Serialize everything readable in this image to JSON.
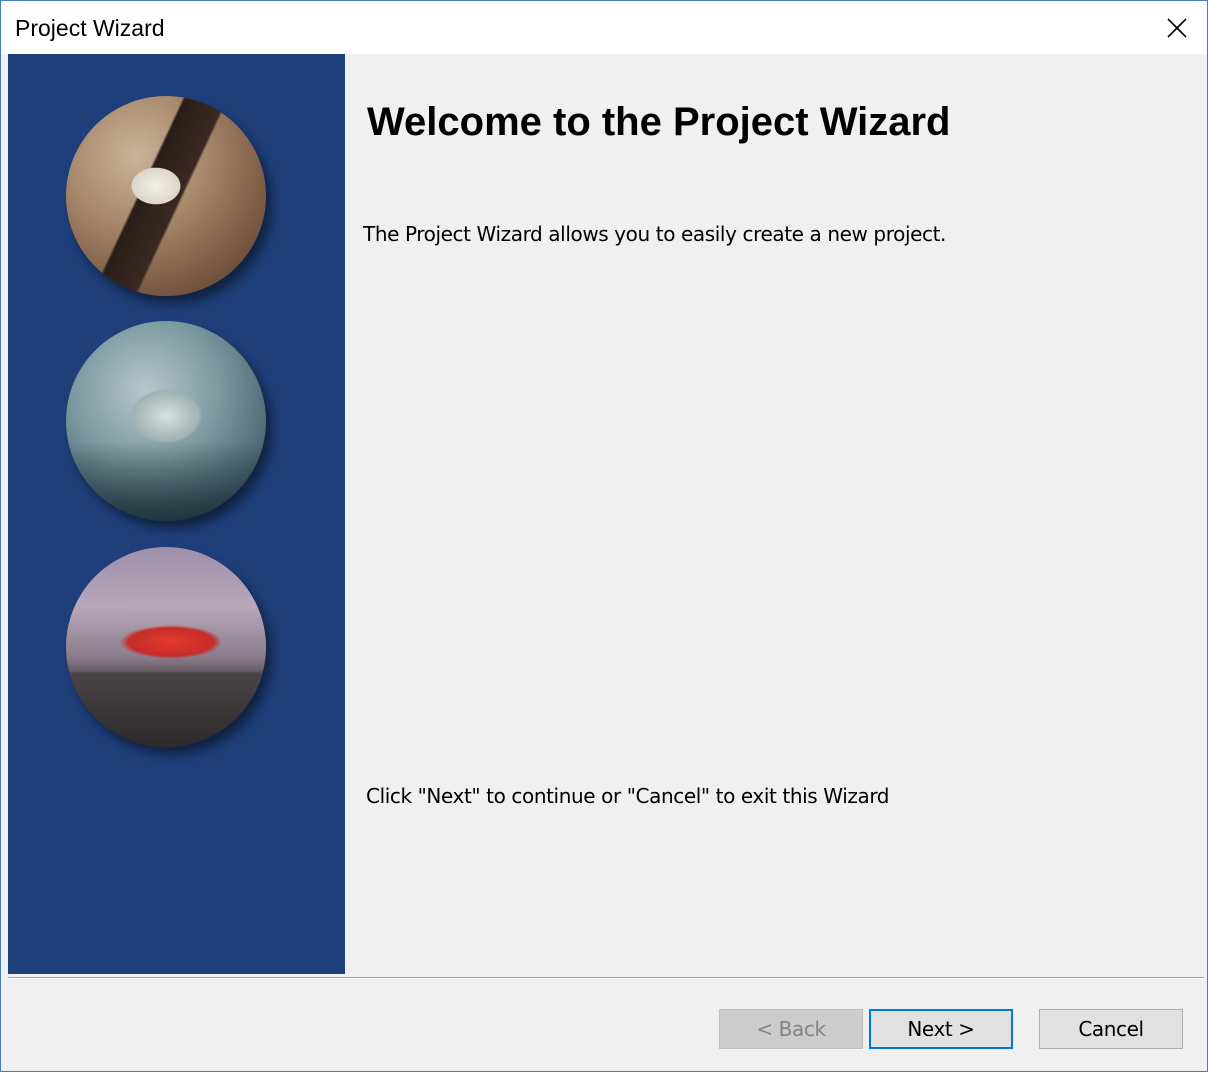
{
  "window": {
    "title": "Project Wizard",
    "close_icon": "close-icon"
  },
  "sidebar": {
    "images": [
      {
        "icon": "stone-texture-image"
      },
      {
        "icon": "fishing-boat-image"
      },
      {
        "icon": "red-car-image"
      }
    ],
    "background_color": "#1e3f7a"
  },
  "content": {
    "heading": "Welcome to the Project Wizard",
    "description": "The Project Wizard allows you to easily create a new project.",
    "instruction": "Click \"Next\" to continue or \"Cancel\" to exit this Wizard"
  },
  "buttons": {
    "back": {
      "label": "< Back",
      "enabled": false
    },
    "next": {
      "label": "Next >",
      "focused": true
    },
    "cancel": {
      "label": "Cancel"
    }
  },
  "colors": {
    "accent": "#0078d7",
    "window_border": "#4a7cc0"
  }
}
